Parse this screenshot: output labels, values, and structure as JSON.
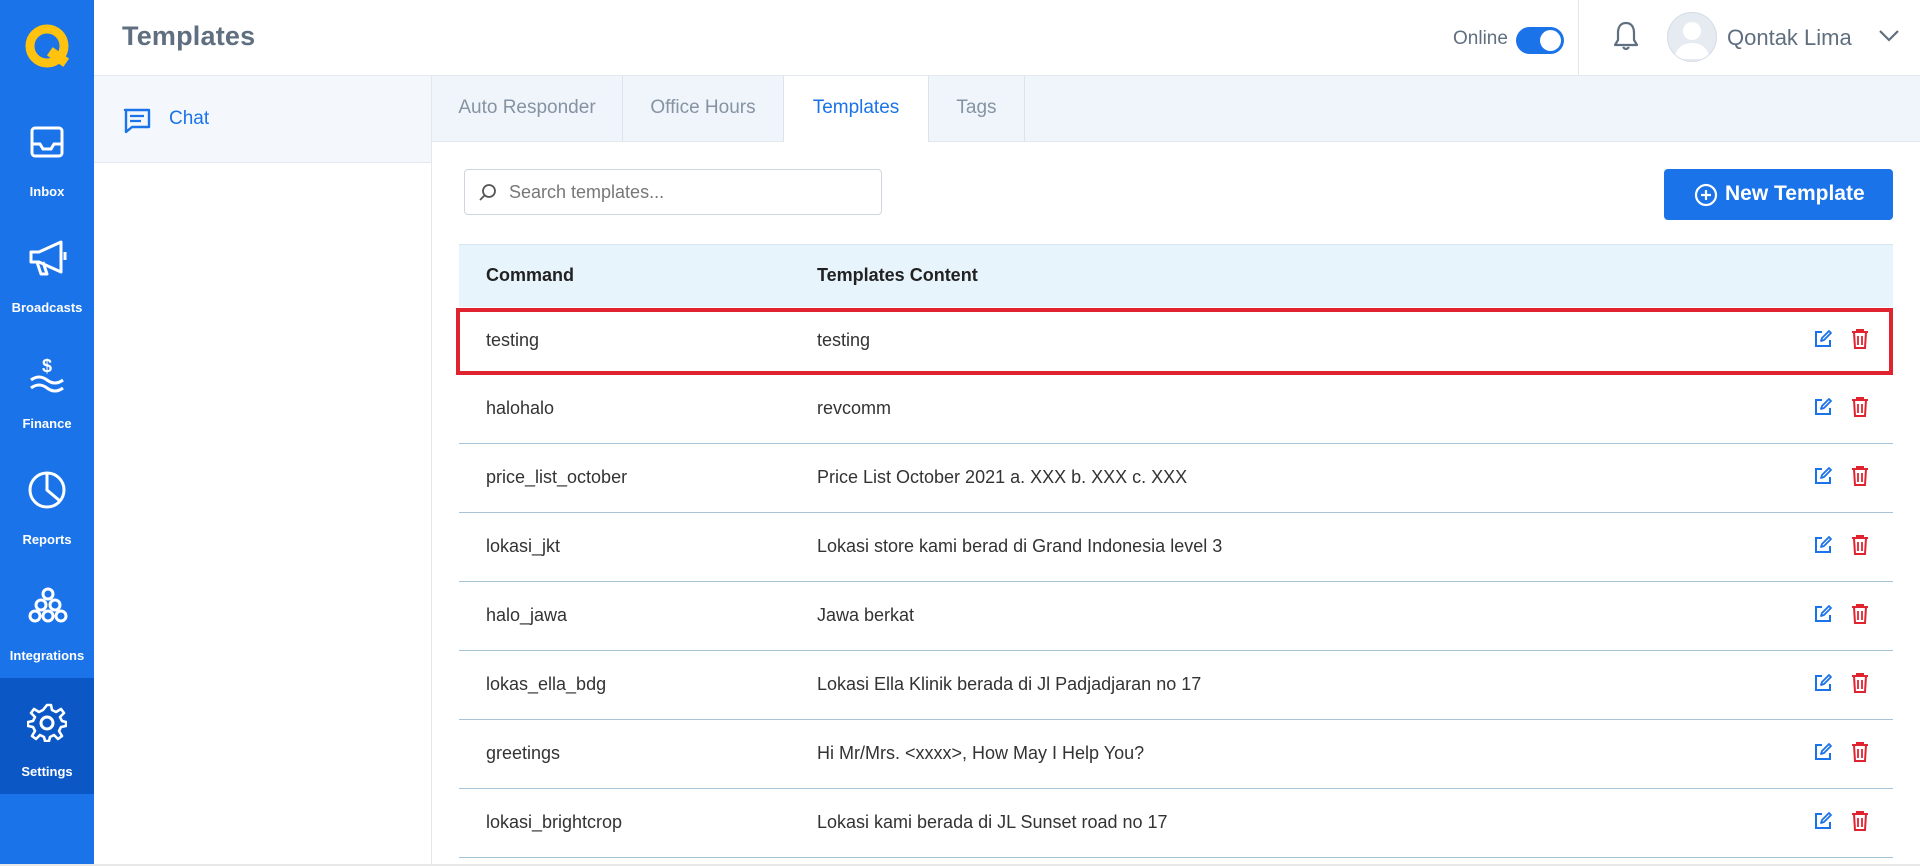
{
  "header": {
    "title": "Templates",
    "online_label": "Online",
    "user_name": "Qontak Lima"
  },
  "nav": {
    "items": [
      {
        "label": "Inbox",
        "icon": "inbox-icon"
      },
      {
        "label": "Broadcasts",
        "icon": "megaphone-icon"
      },
      {
        "label": "Finance",
        "icon": "finance-icon"
      },
      {
        "label": "Reports",
        "icon": "pie-chart-icon"
      },
      {
        "label": "Integrations",
        "icon": "integrations-icon"
      },
      {
        "label": "Settings",
        "icon": "gear-icon"
      }
    ],
    "active": "Settings"
  },
  "subnav": {
    "items": [
      {
        "label": "Chat",
        "icon": "chat-icon"
      }
    ]
  },
  "tabs": [
    {
      "label": "Auto Responder"
    },
    {
      "label": "Office Hours"
    },
    {
      "label": "Templates"
    },
    {
      "label": "Tags"
    }
  ],
  "active_tab": "Templates",
  "search": {
    "placeholder": "Search templates...",
    "value": ""
  },
  "new_button": {
    "label": "New Template"
  },
  "table": {
    "columns": [
      "Command",
      "Templates Content"
    ],
    "rows": [
      {
        "command": "testing",
        "content": "testing"
      },
      {
        "command": "halohalo",
        "content": "revcomm"
      },
      {
        "command": "price_list_october",
        "content": "Price List October 2021 a. XXX b. XXX c. XXX"
      },
      {
        "command": "lokasi_jkt",
        "content": "Lokasi store kami berad di Grand Indonesia level 3"
      },
      {
        "command": "halo_jawa",
        "content": "Jawa berkat"
      },
      {
        "command": "lokas_ella_bdg",
        "content": "Lokasi Ella Klinik berada di Jl Padjadjaran no 17"
      },
      {
        "command": "greetings",
        "content": "Hi Mr/Mrs. <xxxx>, How May I Help You?"
      },
      {
        "command": "lokasi_brightcrop",
        "content": "Lokasi kami berada di JL Sunset road no 17"
      }
    ]
  },
  "colors": {
    "primary": "#1a73e8",
    "nav_active": "#0b57c6",
    "delete": "#e0242f",
    "table_header_bg": "#e8f4fc"
  }
}
